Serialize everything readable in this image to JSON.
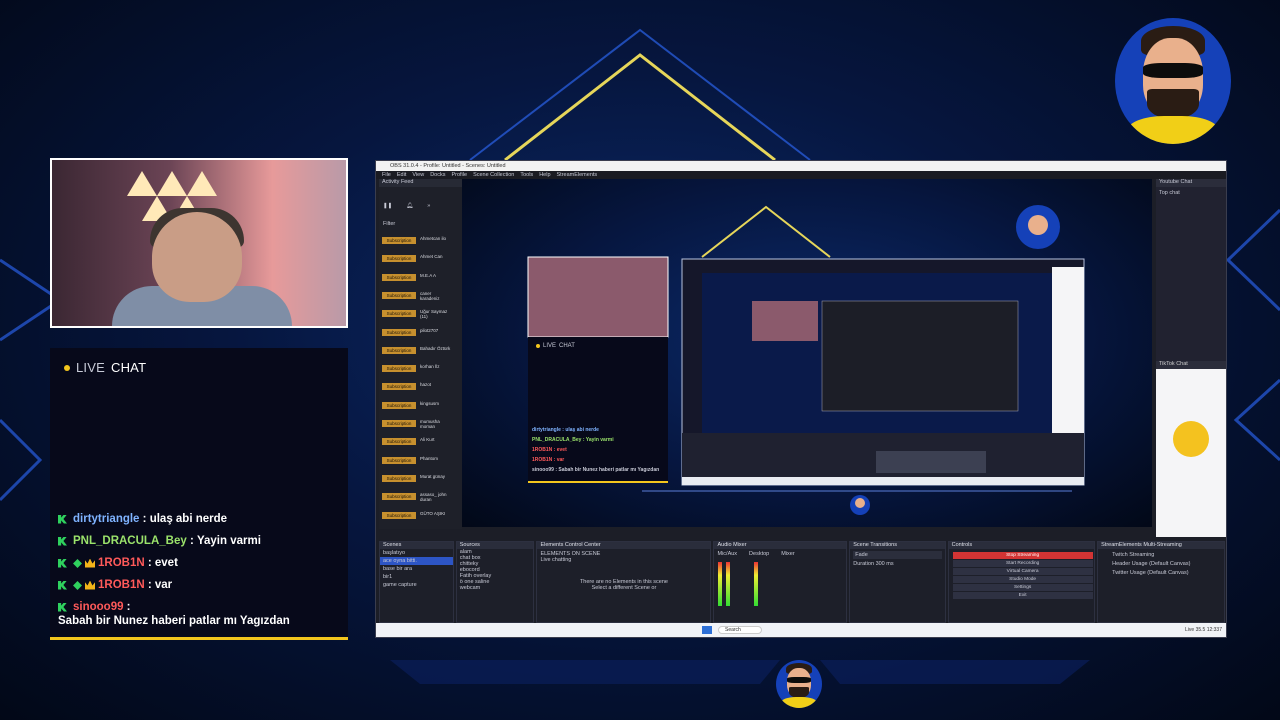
{
  "chat": {
    "live_label": "LIVE",
    "chat_label": "CHAT",
    "messages": [
      {
        "user": "dirtytriangle",
        "text": "ulaş abi nerde",
        "color": "#7fb3ff"
      },
      {
        "user": "PNL_DRACULA_Bey",
        "text": "Yayin varmi",
        "color": "#9be36b"
      },
      {
        "user": "1ROB1N",
        "text": "evet",
        "color": "#ff5a5a"
      },
      {
        "user": "1ROB1N",
        "text": "var",
        "color": "#ff5a5a"
      },
      {
        "user": "sinooo99",
        "text": "Sabah bir Nunez haberi patlar mı Yagızdan",
        "color": "#ff5a5a"
      }
    ]
  },
  "obs": {
    "title": "OBS 31.0.4 - Profile: Untitled - Scenes: Untitled",
    "menu": [
      "File",
      "Edit",
      "View",
      "Docks",
      "Profile",
      "Scene Collection",
      "Tools",
      "Help",
      "StreamElements"
    ],
    "activity_feed": {
      "title": "Activity Feed",
      "filter": "Filter",
      "badge": "Subscription",
      "names": [
        "Ahmetcan ilo",
        "Ahmet Can",
        "M.E.A A",
        "caner karadeniz",
        "Uğur Saymaz (11)",
        "pilot2707",
        "Bahadır Öztürk",
        "korhan İlz",
        "hazot",
        "kingsusm",
        "mumusha moman",
        "Ali Kurt",
        "Phantom",
        "Murat günay",
        "assaso_ john duran",
        "GÜTO AŞIKI"
      ]
    },
    "youtube_chat": {
      "title": "Youtube Chat",
      "mode": "Top chat"
    },
    "tiktok_chat": {
      "title": "TikTok Chat"
    },
    "docks": {
      "scenes": {
        "title": "Scenes",
        "items": [
          "başlatıyo",
          "ace oyna bitti.",
          "base bir ara",
          "bir1",
          "game capture"
        ]
      },
      "sources": {
        "title": "Sources",
        "items": [
          "alam",
          "chat box",
          "chitteky",
          "ebocord",
          "Fatih overlay",
          "ö one saline",
          "webcam"
        ]
      },
      "elements": {
        "title": "Elements Control Center",
        "on_scene": "ELEMENTS ON SCENE",
        "chatting": "Live chatting",
        "empty": "There are no Elements in this scene",
        "hint": "Select a different Scene or"
      },
      "mixer": {
        "title": "Audio Mixer",
        "channels": [
          "Mic/Aux",
          "Desktop",
          "Mixer"
        ]
      },
      "transitions": {
        "title": "Scene Transitions",
        "type": "Fade",
        "duration_label": "Duration",
        "duration": "300 ms"
      },
      "controls": {
        "title": "Controls",
        "stop": "Stop Streaming",
        "start_rec": "Start Recording",
        "virtual": "Virtual Camera",
        "studio": "Studio Mode",
        "settings": "Settings",
        "exit": "Exit"
      },
      "multistream": {
        "title": "StreamElements Multi-Streaming",
        "items": [
          "Twitch Streaming",
          "Header Usage (Default Canvas)",
          "Twitter Usage (Default Canvas)"
        ]
      }
    },
    "taskbar": {
      "search": "Search",
      "status": "Live 35.5 12:337"
    }
  },
  "preview_chat": {
    "live_label": "LIVE",
    "chat_label": "CHAT",
    "lines": [
      "dirtytriangle : ulaş abi nerde",
      "PNL_DRACULA_Bey : Yayin varmi",
      "1ROB1N : evet",
      "1ROB1N : var",
      "sinooo99 : Sabah bir Nunez haberi patlar mı Yagızdan"
    ]
  },
  "colors": {
    "accent": "#f3c61d",
    "background": "#06163f",
    "neon": "#3a7bff"
  }
}
